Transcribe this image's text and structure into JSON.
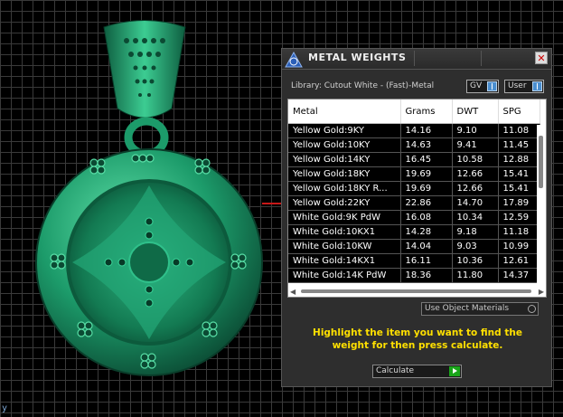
{
  "viewport": {
    "axis_label": "y"
  },
  "panel": {
    "title": "METAL WEIGHTS",
    "close_label": "✕",
    "library_label": "Library: Cutout White - (Fast)-Metal",
    "gv_label": "GV",
    "user_label": "User",
    "use_object_materials_label": "Use Object Materials",
    "hint": "Highlight the item you want to find the weight for then press calculate.",
    "calculate_label": "Calculate"
  },
  "table": {
    "columns": [
      "Metal",
      "Grams",
      "DWT",
      "SPG"
    ],
    "rows": [
      [
        "Yellow Gold:9KY",
        "14.16",
        "9.10",
        "11.08"
      ],
      [
        "Yellow Gold:10KY",
        "14.63",
        "9.41",
        "11.45"
      ],
      [
        "Yellow Gold:14KY",
        "16.45",
        "10.58",
        "12.88"
      ],
      [
        "Yellow Gold:18KY",
        "19.69",
        "12.66",
        "15.41"
      ],
      [
        "Yellow Gold:18KY R...",
        "19.69",
        "12.66",
        "15.41"
      ],
      [
        "Yellow Gold:22KY",
        "22.86",
        "14.70",
        "17.89"
      ],
      [
        "White Gold:9K PdW",
        "16.08",
        "10.34",
        "12.59"
      ],
      [
        "White Gold:10KX1",
        "14.28",
        "9.18",
        "11.18"
      ],
      [
        "White Gold:10KW",
        "14.04",
        "9.03",
        "10.99"
      ],
      [
        "White Gold:14KX1",
        "16.11",
        "10.36",
        "12.61"
      ],
      [
        "White Gold:14K PdW",
        "18.36",
        "11.80",
        "14.37"
      ]
    ]
  },
  "colors": {
    "model_green": "#1f9a6a",
    "hint_yellow": "#ffe000",
    "axis_red": "#c81818"
  }
}
